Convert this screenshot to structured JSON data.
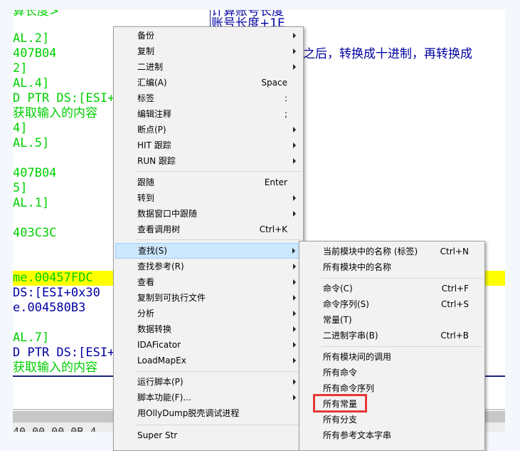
{
  "code_pane": {
    "lines": [
      {
        "text": "算长度>",
        "color": "green"
      },
      {
        "text": "AL.2]",
        "color": "green"
      },
      {
        "text": "407B04",
        "color": "green"
      },
      {
        "text": "2]",
        "color": "green"
      },
      {
        "text": "AL.4]",
        "color": "green"
      },
      {
        "text": "D PTR DS:[ESI+",
        "color": "green"
      },
      {
        "text": "获取输入的内容",
        "color": "green"
      },
      {
        "text": "4]",
        "color": "green"
      },
      {
        "text": "AL.5]",
        "color": "green"
      },
      {
        "text": "407B04",
        "color": "green"
      },
      {
        "text": "5]",
        "color": "green"
      },
      {
        "text": "AL.1]",
        "color": "green"
      },
      {
        "text": "403C3C",
        "color": "green"
      },
      {
        "text": "me.00457FDC",
        "color": "green"
      },
      {
        "text": " DS:[ESI+0x30",
        "color": "blue"
      },
      {
        "text": "e.004580B3",
        "color": "blue"
      },
      {
        "text": "AL.7]",
        "color": "green"
      },
      {
        "text": "D PTR DS:[ESI+",
        "color": "blue"
      },
      {
        "text": "获取输入的内容",
        "color": "green"
      }
    ],
    "comments": [
      "计算账号长度",
      "账号长度+1E",
      "之后，转换成十进制，再转换成"
    ],
    "bottom_text": "40.00 00 0B 4"
  },
  "main_menu": {
    "items": [
      {
        "label": "备份",
        "shortcut": "",
        "submenu": true
      },
      {
        "label": "复制",
        "shortcut": "",
        "submenu": true
      },
      {
        "label": "二进制",
        "shortcut": "",
        "submenu": true
      },
      {
        "label": "汇编(A)",
        "shortcut": "Space",
        "submenu": false
      },
      {
        "label": "标签",
        "shortcut": ":",
        "submenu": false
      },
      {
        "label": "编辑注释",
        "shortcut": ";",
        "submenu": false
      },
      {
        "label": "断点(P)",
        "shortcut": "",
        "submenu": true
      },
      {
        "label": "HIT 跟踪",
        "shortcut": "",
        "submenu": true
      },
      {
        "label": "RUN 跟踪",
        "shortcut": "",
        "submenu": true
      },
      {
        "label": "跟随",
        "shortcut": "Enter",
        "submenu": false
      },
      {
        "label": "转到",
        "shortcut": "",
        "submenu": true
      },
      {
        "label": "数据窗口中跟随",
        "shortcut": "",
        "submenu": true
      },
      {
        "label": "查看调用树",
        "shortcut": "Ctrl+K",
        "submenu": false
      },
      {
        "label": "查找(S)",
        "shortcut": "",
        "submenu": true
      },
      {
        "label": "查找参考(R)",
        "shortcut": "",
        "submenu": true
      },
      {
        "label": "查看",
        "shortcut": "",
        "submenu": true
      },
      {
        "label": "复制到可执行文件",
        "shortcut": "",
        "submenu": true
      },
      {
        "label": "分析",
        "shortcut": "",
        "submenu": true
      },
      {
        "label": "数据转换",
        "shortcut": "",
        "submenu": true
      },
      {
        "label": "IDAFicator",
        "shortcut": "",
        "submenu": true
      },
      {
        "label": "LoadMapEx",
        "shortcut": "",
        "submenu": true
      },
      {
        "label": "运行脚本(P)",
        "shortcut": "",
        "submenu": true
      },
      {
        "label": "脚本功能(F)...",
        "shortcut": "",
        "submenu": true
      },
      {
        "label": "用OllyDump脱壳调试进程",
        "shortcut": "",
        "submenu": false
      },
      {
        "label": "Super Str",
        "shortcut": "",
        "submenu": false
      }
    ]
  },
  "sub_menu": {
    "items": [
      {
        "label": "当前模块中的名称 (标签)",
        "shortcut": "Ctrl+N"
      },
      {
        "label": "所有模块中的名称",
        "shortcut": ""
      },
      {
        "label": "命令(C)",
        "shortcut": "Ctrl+F"
      },
      {
        "label": "命令序列(S)",
        "shortcut": "Ctrl+S"
      },
      {
        "label": "常量(T)",
        "shortcut": ""
      },
      {
        "label": "二进制字串(B)",
        "shortcut": "Ctrl+B"
      },
      {
        "label": "所有模块间的调用",
        "shortcut": ""
      },
      {
        "label": "所有命令",
        "shortcut": ""
      },
      {
        "label": "所有命令序列",
        "shortcut": ""
      },
      {
        "label": "所有常量",
        "shortcut": ""
      },
      {
        "label": "所有分支",
        "shortcut": ""
      },
      {
        "label": "所有参考文本字串",
        "shortcut": ""
      }
    ]
  },
  "colors": {
    "highlight_row": "#ffff00",
    "menu_hover": "#cce8ff",
    "emphasis_box": "#e53935"
  }
}
